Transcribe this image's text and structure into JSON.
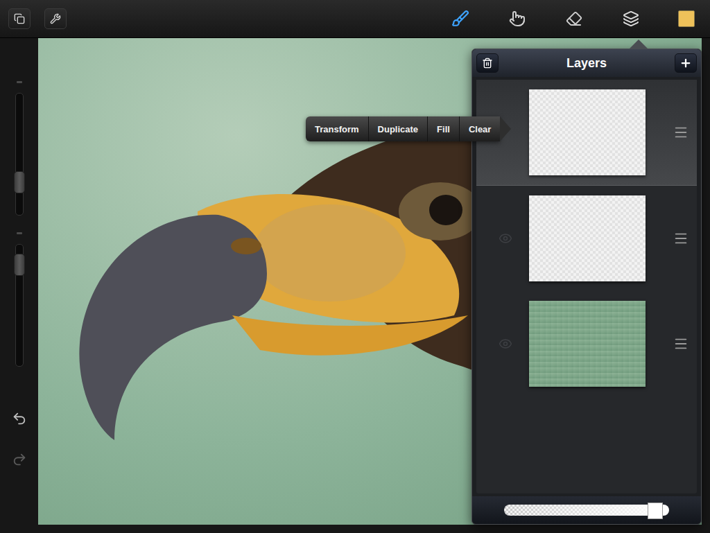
{
  "toolbar": {
    "tools": [
      {
        "kind": "brush",
        "selected": true
      },
      {
        "kind": "smudge",
        "selected": false
      },
      {
        "kind": "eraser",
        "selected": false
      },
      {
        "kind": "layers",
        "selected": true
      }
    ],
    "color": "#eec15a"
  },
  "sidebar": {
    "size_slider": {
      "level": 0.23
    },
    "opacity_slider": {
      "level": 0.91
    }
  },
  "layer_menu": {
    "items": [
      "Transform",
      "Duplicate",
      "Fill",
      "Clear"
    ]
  },
  "layers_panel": {
    "title": "Layers",
    "layers": [
      {
        "selected": true,
        "transparent": true,
        "color": "#f2f2f2"
      },
      {
        "selected": false,
        "transparent": true,
        "color": "#f2f2f2"
      },
      {
        "selected": false,
        "transparent": false,
        "color": "#7fa585"
      }
    ],
    "opacity": {
      "level": 0.95
    }
  }
}
